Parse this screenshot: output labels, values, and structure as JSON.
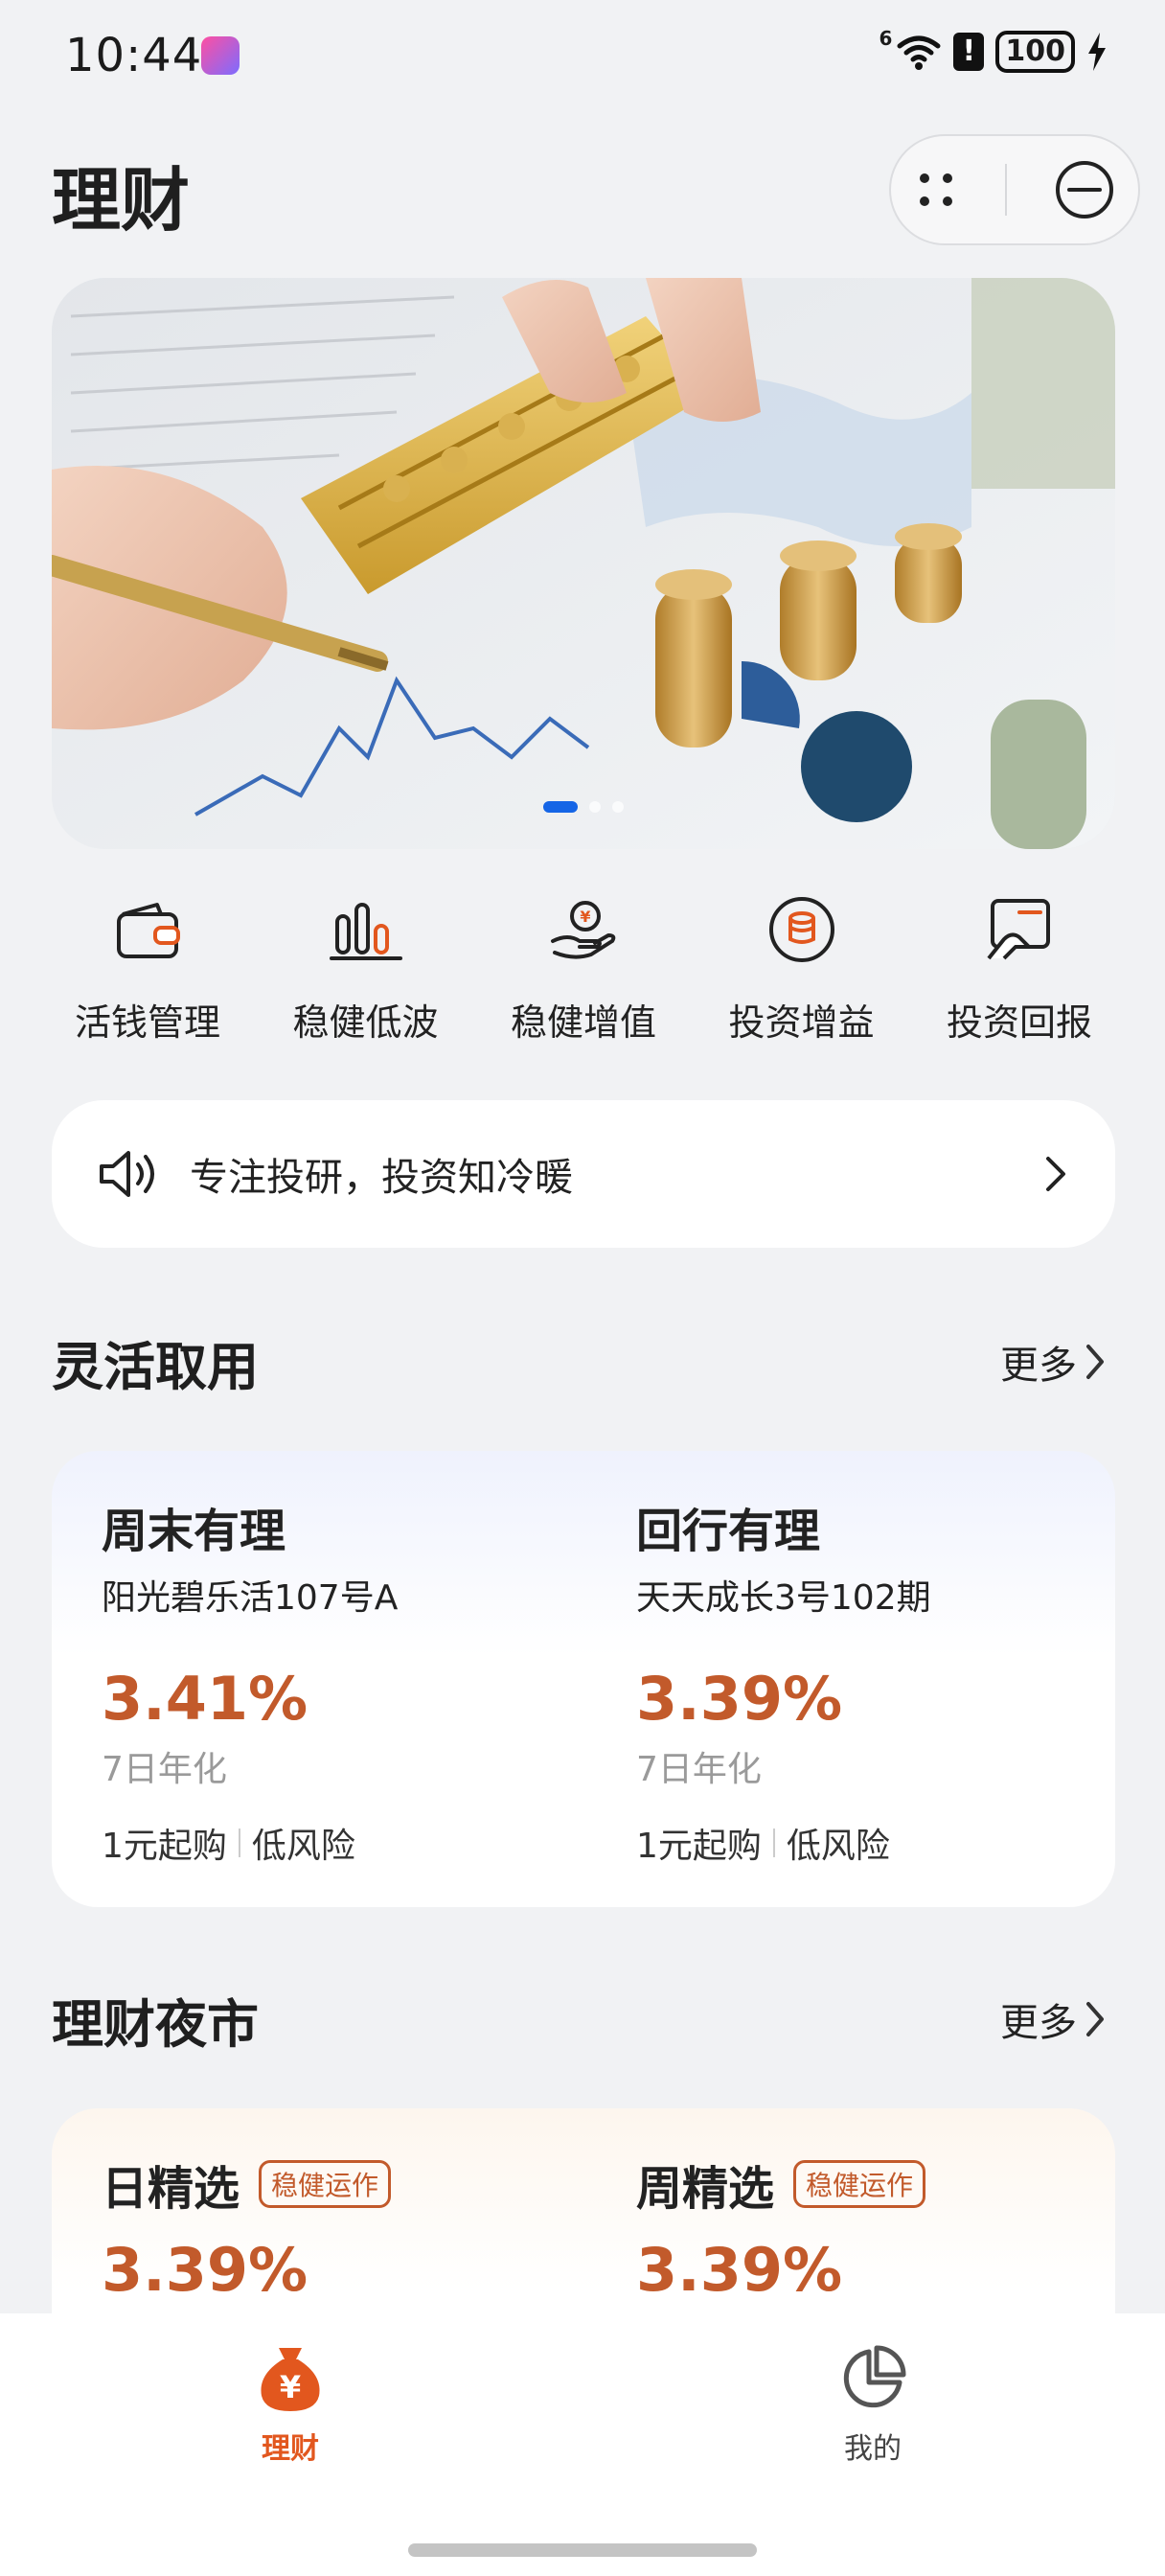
{
  "status": {
    "time": "10:44",
    "network": "6",
    "battery": "100"
  },
  "header": {
    "title": "理财"
  },
  "quick": [
    {
      "label": "活钱管理",
      "icon": "wallet-icon"
    },
    {
      "label": "稳健低波",
      "icon": "bar-chart-icon"
    },
    {
      "label": "稳健增值",
      "icon": "hand-coin-icon"
    },
    {
      "label": "投资增益",
      "icon": "coin-stack-icon"
    },
    {
      "label": "投资回报",
      "icon": "card-hand-icon"
    }
  ],
  "notice": {
    "text": "专注投研，投资知冷暖"
  },
  "section1": {
    "title": "灵活取用",
    "more": "更多",
    "products": [
      {
        "title": "周末有理",
        "subtitle": "阳光碧乐活107号A",
        "rate": "3.41%",
        "rate_label": "7日年化",
        "min": "1元起购",
        "risk": "低风险"
      },
      {
        "title": "回行有理",
        "subtitle": "天天成长3号102期",
        "rate": "3.39%",
        "rate_label": "7日年化",
        "min": "1元起购",
        "risk": "低风险"
      }
    ]
  },
  "section2": {
    "title": "理财夜市",
    "more": "更多",
    "products": [
      {
        "title": "日精选",
        "tag": "稳健运作",
        "rate": "3.39%"
      },
      {
        "title": "周精选",
        "tag": "稳健运作",
        "rate": "3.39%"
      }
    ]
  },
  "tabs": [
    {
      "label": "理财",
      "active": true
    },
    {
      "label": "我的",
      "active": false
    }
  ],
  "colors": {
    "accent": "#c25a2b",
    "tab_active": "#e2571e",
    "banner_dot": "#1565e6"
  }
}
